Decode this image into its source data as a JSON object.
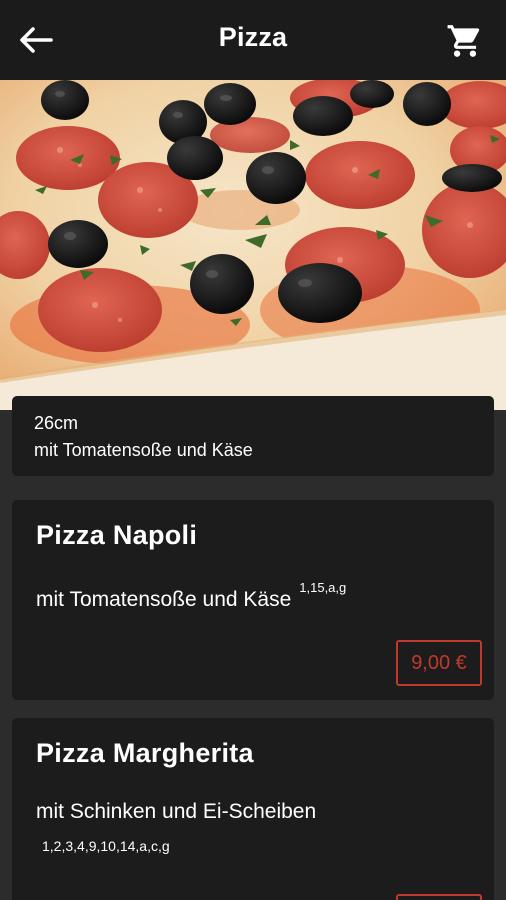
{
  "header": {
    "title": "Pizza",
    "back_icon": "arrow-left-icon",
    "cart_icon": "cart-icon"
  },
  "category_info": {
    "size": "26cm",
    "description": "mit Tomatensoße und Käse"
  },
  "products": [
    {
      "name": "Pizza Napoli",
      "description": "mit Tomatensoße und Käse",
      "allergens": "1,15,a,g",
      "price": "9,00 €"
    },
    {
      "name": "Pizza Margherita",
      "description": "mit Schinken und Ei-Scheiben",
      "allergens": "1,2,3,4,9,10,14,a,c,g",
      "price": ""
    }
  ],
  "colors": {
    "header_bg": "#1b1b1b",
    "card_bg": "#1c1c1c",
    "page_bg": "#2c2c2c",
    "price_accent": "#c0392b"
  }
}
